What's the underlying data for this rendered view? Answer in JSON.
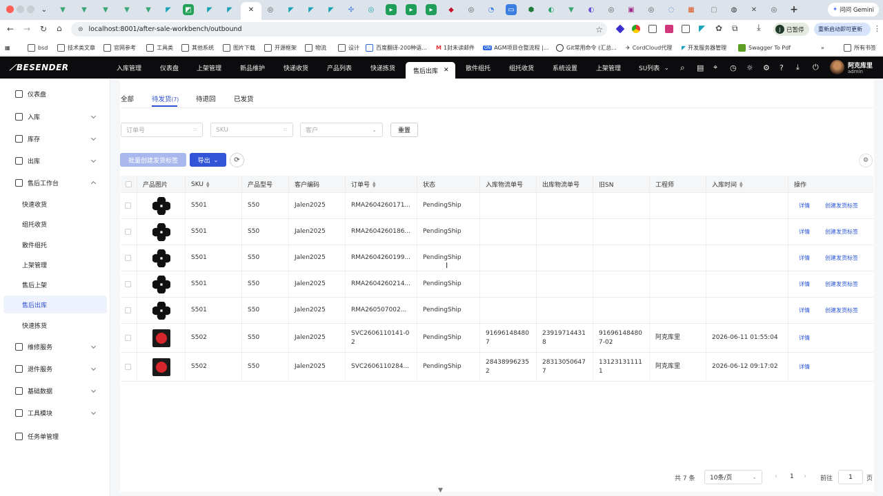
{
  "browser": {
    "url": "localhost:8001/after-sale-workbench/outbound",
    "profile_badge": "已暂停",
    "profile_letter": "J",
    "update_button": "重新启动即可更新",
    "gemini_button": "问问 Gemini",
    "bookmarks": [
      "bsd",
      "技术类文章",
      "官网参考",
      "工具类",
      "其他系统",
      "图片下载",
      "开源框架",
      "物流",
      "设计",
      "百度翻译-200种语...",
      "1封未读邮件",
      "AGM项目仓整流程 |...",
      "Git常用命令 (汇总...",
      "CordCloud代理",
      "开发服务器管理",
      "Swagger To Pdf",
      "所有书签"
    ],
    "dev_badge": "ON"
  },
  "app": {
    "logo": "BESENDER",
    "nav": [
      "入库管理",
      "仪表盘",
      "上架管理",
      "新品维护",
      "快递收货",
      "产品列表",
      "快递拣货",
      "售后出库",
      "散件组托",
      "组托收货",
      "系统设置",
      "上架管理",
      "SU列表"
    ],
    "active_nav": "售后出库",
    "user_name": "阿克库里",
    "user_role": "admin"
  },
  "sidebar": {
    "items": [
      {
        "label": "仪表盘",
        "icon": "home-icon"
      },
      {
        "label": "入库",
        "icon": "inbound-icon"
      },
      {
        "label": "库存",
        "icon": "inventory-icon"
      },
      {
        "label": "出库",
        "icon": "outbound-icon"
      },
      {
        "label": "售后工作台",
        "icon": "after-sale-icon"
      },
      {
        "label": "维修服务",
        "icon": "wrench-icon"
      },
      {
        "label": "退件服务",
        "icon": "return-icon"
      },
      {
        "label": "基础数据",
        "icon": "data-icon"
      },
      {
        "label": "工具模块",
        "icon": "tools-icon"
      },
      {
        "label": "任务单管理",
        "icon": "task-icon"
      }
    ],
    "sub_items": [
      "快速收货",
      "组托收货",
      "散件组托",
      "上架管理",
      "售后上架",
      "售后出库",
      "快速拣货"
    ],
    "active_sub": "售后出库"
  },
  "status_tabs": {
    "all": "全部",
    "pending": "待发货",
    "pending_count": "(7)",
    "to_return": "待退回",
    "shipped": "已发货"
  },
  "filters": {
    "order_placeholder": "订单号",
    "sku_placeholder": "SKU",
    "customer_placeholder": "客户",
    "reset": "重置"
  },
  "actions": {
    "batch_create": "批量创建发货标签",
    "export": "导出"
  },
  "table": {
    "columns": [
      "产品图片",
      "SKU",
      "产品型号",
      "客户编码",
      "订单号",
      "状态",
      "入库物流单号",
      "出库物流单号",
      "旧SN",
      "工程师",
      "入库时间",
      "操作"
    ],
    "rows": [
      {
        "sku": "S501",
        "model": "S50",
        "customer": "Jalen2025",
        "order": "RMA2604260171...",
        "status": "PendingShip",
        "in_track": "",
        "out_track": "",
        "old_sn": "",
        "engineer": "",
        "in_time": "",
        "detail": "详情",
        "create": "创建发货标签"
      },
      {
        "sku": "S501",
        "model": "S50",
        "customer": "Jalen2025",
        "order": "RMA2604260186...",
        "status": "PendingShip",
        "in_track": "",
        "out_track": "",
        "old_sn": "",
        "engineer": "",
        "in_time": "",
        "detail": "详情",
        "create": "创建发货标签"
      },
      {
        "sku": "S501",
        "model": "S50",
        "customer": "Jalen2025",
        "order": "RMA2604260199...",
        "status": "PendingShip",
        "in_track": "",
        "out_track": "",
        "old_sn": "",
        "engineer": "",
        "in_time": "",
        "detail": "详情",
        "create": "创建发货标签"
      },
      {
        "sku": "S501",
        "model": "S50",
        "customer": "Jalen2025",
        "order": "RMA2604260214...",
        "status": "PendingShip",
        "in_track": "",
        "out_track": "",
        "old_sn": "",
        "engineer": "",
        "in_time": "",
        "detail": "详情",
        "create": "创建发货标签"
      },
      {
        "sku": "S501",
        "model": "S50",
        "customer": "Jalen2025",
        "order": "RMA260507002...",
        "status": "PendingShip",
        "in_track": "",
        "out_track": "",
        "old_sn": "",
        "engineer": "",
        "in_time": "",
        "detail": "详情",
        "create": "创建发货标签"
      },
      {
        "sku": "S502",
        "model": "S50",
        "customer": "Jalen2025",
        "order": "SVC2606110141-02",
        "status": "PendingShip",
        "in_track": "916961484807",
        "out_track": "239197144318",
        "old_sn": "916961484807-02",
        "engineer": "阿克库里",
        "in_time": "2026-06-11 01:55:04",
        "detail": "详情",
        "create": ""
      },
      {
        "sku": "S502",
        "model": "S50",
        "customer": "Jalen2025",
        "order": "SVC2606110284...",
        "status": "PendingShip",
        "in_track": "284389962352",
        "out_track": "283130506477",
        "old_sn": "131231311111",
        "engineer": "阿克库里",
        "in_time": "2026-06-12 09:17:02",
        "detail": "详情",
        "create": ""
      }
    ]
  },
  "pagination": {
    "total": "共 7 条",
    "page_size": "10条/页",
    "current_page": "1",
    "goto_label": "前往",
    "goto_value": "1",
    "page_unit": "页"
  },
  "colors": {
    "primary": "#3255d8",
    "primary_light": "#a9b8ec",
    "header_bg": "#0c0c0f",
    "active_sub_bg": "#eef2ff"
  }
}
